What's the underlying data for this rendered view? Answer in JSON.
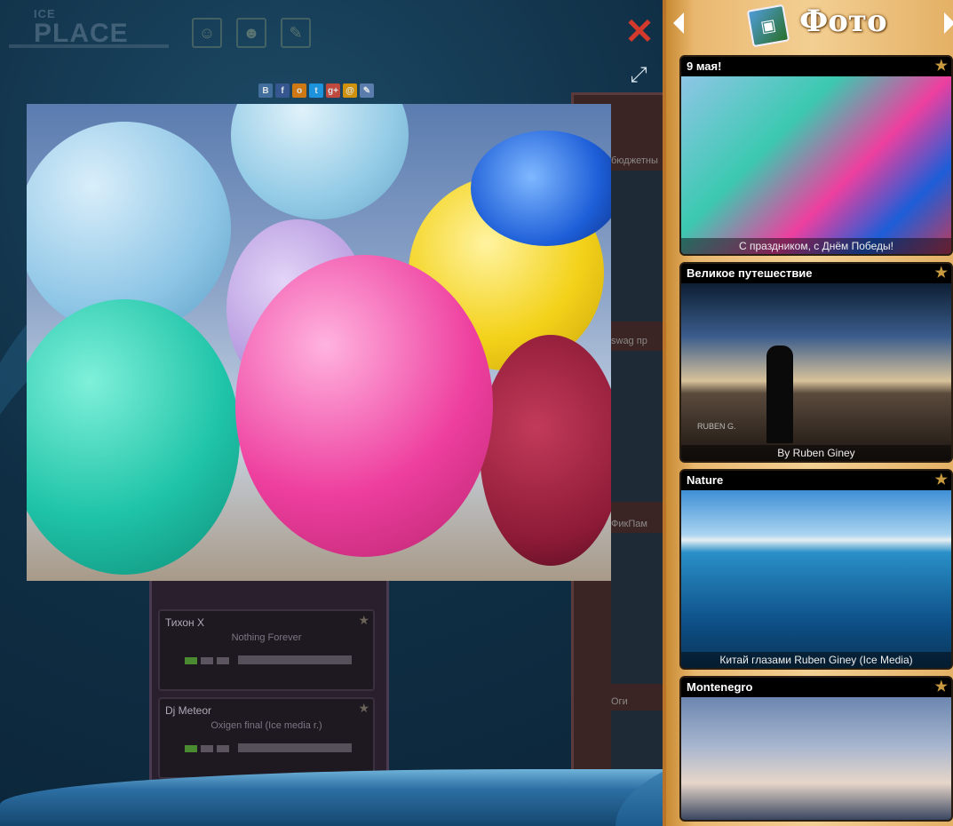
{
  "brand": {
    "logo_top": "ICE",
    "logo_main": "PLACE"
  },
  "share": {
    "icons": [
      {
        "label": "В",
        "name": "vk-icon",
        "color": "#4a76a8"
      },
      {
        "label": "f",
        "name": "facebook-icon",
        "color": "#3b5998"
      },
      {
        "label": "о",
        "name": "odnoklassniki-icon",
        "color": "#ee8208"
      },
      {
        "label": "t",
        "name": "twitter-icon",
        "color": "#1da1f2"
      },
      {
        "label": "g+",
        "name": "googleplus-icon",
        "color": "#dd4b39"
      },
      {
        "label": "@",
        "name": "mailru-icon",
        "color": "#f0a000"
      },
      {
        "label": "✎",
        "name": "livejournal-icon",
        "color": "#6688bb"
      }
    ]
  },
  "background_tracks": [
    {
      "artist": "Тихон X",
      "title": "Nothing Forever"
    },
    {
      "artist": "Dj Meteor",
      "title": "Oxigen final (Ice media r.)"
    }
  ],
  "background_right_labels": [
    "бюджетны",
    "swag пр",
    "ФикПам",
    "Оги"
  ],
  "sidebar": {
    "title": "Фото",
    "cards": [
      {
        "title": "9 мая!",
        "caption": "С праздником, с Днём Победы!"
      },
      {
        "title": "Великое путешествие",
        "caption": "By Ruben Giney",
        "watermark": "RUBEN G."
      },
      {
        "title": "Nature",
        "caption": "Китай глазами Ruben Giney (Ice Media)"
      },
      {
        "title": "Montenegro",
        "caption": ""
      }
    ]
  },
  "colors": {
    "close": "#d43a2c",
    "sidebar": "#e9b870",
    "star": "#c89a40"
  }
}
